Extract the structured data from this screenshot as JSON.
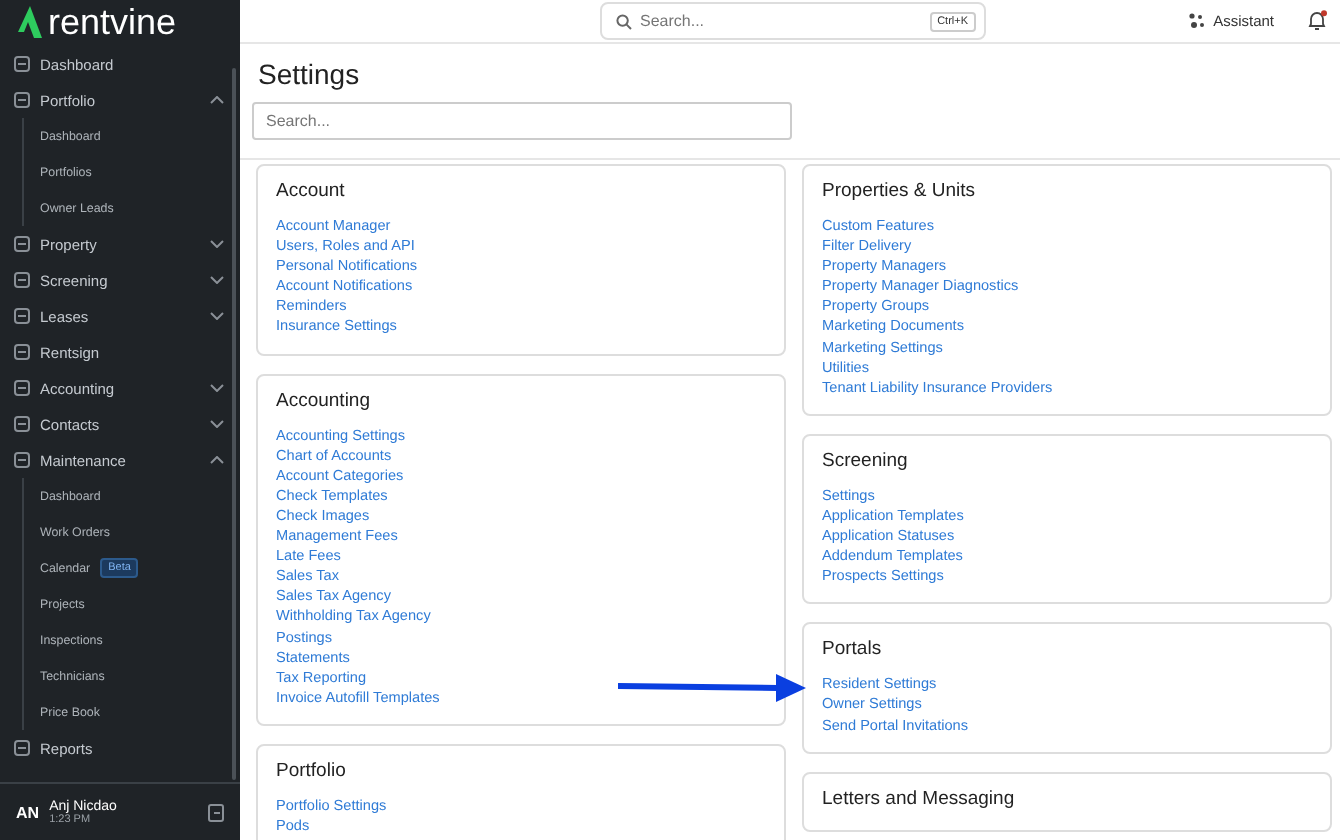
{
  "brand": {
    "name": "rentvine"
  },
  "nav": [
    {
      "label": "Dashboard"
    },
    {
      "label": "Portfolio",
      "expanded": true,
      "children": [
        {
          "label": "Dashboard"
        },
        {
          "label": "Portfolios"
        },
        {
          "label": "Owner Leads"
        }
      ]
    },
    {
      "label": "Property",
      "expanded": false
    },
    {
      "label": "Screening",
      "expanded": false
    },
    {
      "label": "Leases",
      "expanded": false
    },
    {
      "label": "Rentsign"
    },
    {
      "label": "Accounting",
      "expanded": false
    },
    {
      "label": "Contacts",
      "expanded": false
    },
    {
      "label": "Maintenance",
      "expanded": true,
      "children": [
        {
          "label": "Dashboard"
        },
        {
          "label": "Work Orders"
        },
        {
          "label": "Calendar",
          "badge": "Beta"
        },
        {
          "label": "Projects"
        },
        {
          "label": "Inspections"
        },
        {
          "label": "Technicians"
        },
        {
          "label": "Price Book"
        }
      ]
    },
    {
      "label": "Reports"
    }
  ],
  "user": {
    "initials": "AN",
    "name": "Anj Nicdao",
    "time": "1:23 PM"
  },
  "topbar": {
    "search": {
      "placeholder": "Search...",
      "shortcut": "Ctrl+K"
    },
    "assistant": "Assistant",
    "bell": {
      "unread": true
    }
  },
  "page": {
    "title": "Settings",
    "search": {
      "placeholder": "Search..."
    }
  },
  "columns": [
    [
      {
        "title": "Account",
        "links": [
          "Account Manager",
          "Users, Roles and API",
          "Personal Notifications",
          "Account Notifications",
          "Reminders",
          "Insurance Settings"
        ]
      },
      {
        "title": "Accounting",
        "links": [
          "Accounting Settings",
          "Chart of Accounts",
          "Account Categories",
          "Check Templates",
          "Check Images",
          "Management Fees",
          "Late Fees",
          "Sales Tax",
          "Sales Tax Agency",
          "Withholding Tax Agency",
          "Postings",
          "Statements",
          "Tax Reporting",
          "Invoice Autofill Templates"
        ]
      },
      {
        "title": "Portfolio",
        "links": [
          "Portfolio Settings",
          "Pods"
        ]
      }
    ],
    [
      {
        "title": "Properties & Units",
        "links": [
          "Custom Features",
          "Filter Delivery",
          "Property Managers",
          "Property Manager Diagnostics",
          "Property Groups",
          "Marketing Documents",
          "Marketing Settings",
          "Utilities",
          "Tenant Liability Insurance Providers"
        ]
      },
      {
        "title": "Screening",
        "links": [
          "Settings",
          "Application Templates",
          "Application Statuses",
          "Addendum Templates",
          "Prospects Settings"
        ]
      },
      {
        "title": "Portals",
        "links": [
          "Resident Settings",
          "Owner Settings",
          "Send Portal Invitations"
        ]
      },
      {
        "title": "Letters and Messaging"
      }
    ]
  ]
}
